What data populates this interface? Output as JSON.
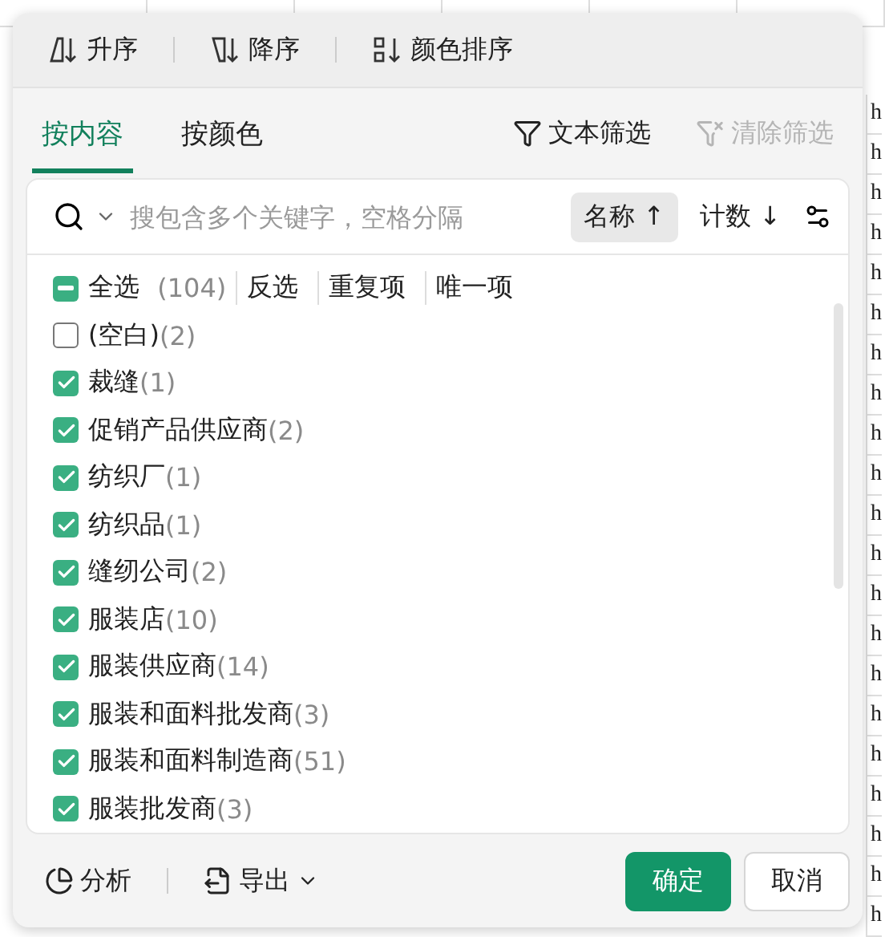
{
  "sort_toolbar": [
    {
      "label": "升序",
      "kind": "ascending"
    },
    {
      "label": "降序",
      "kind": "descending"
    },
    {
      "label": "颜色排序",
      "kind": "color"
    }
  ],
  "tabs": [
    {
      "label": "按内容",
      "selected": true
    },
    {
      "label": "按颜色",
      "selected": false
    }
  ],
  "filter_actions": [
    {
      "label": "文本筛选",
      "disabled": false
    },
    {
      "label": "清除筛选",
      "disabled": true
    }
  ],
  "search": {
    "placeholder": "搜包含多个关键字，空格分隔"
  },
  "sort_options": [
    {
      "label": "名称 ↑",
      "selected": true
    },
    {
      "label": "计数 ↓",
      "selected": false
    }
  ],
  "select_all": {
    "label": "全选",
    "count": "(104)",
    "checked": true,
    "indeterminate": true,
    "links": [
      "反选",
      "重复项",
      "唯一项"
    ]
  },
  "items": [
    {
      "name": "(空白)",
      "count": "(2)",
      "checked": false
    },
    {
      "name": "裁缝",
      "count": "(1)",
      "checked": true
    },
    {
      "name": "促销产品供应商",
      "count": "(2)",
      "checked": true
    },
    {
      "name": "纺织厂",
      "count": "(1)",
      "checked": true
    },
    {
      "name": "纺织品",
      "count": "(1)",
      "checked": true
    },
    {
      "name": "缝纫公司",
      "count": "(2)",
      "checked": true
    },
    {
      "name": "服装店",
      "count": "(10)",
      "checked": true
    },
    {
      "name": "服装供应商",
      "count": "(14)",
      "checked": true
    },
    {
      "name": "服装和面料批发商",
      "count": "(3)",
      "checked": true
    },
    {
      "name": "服装和面料制造商",
      "count": "(51)",
      "checked": true
    },
    {
      "name": "服装批发商",
      "count": "(3)",
      "checked": true
    }
  ],
  "footer": {
    "tools": [
      {
        "label": "分析",
        "kind": "analyze"
      },
      {
        "label": "导出",
        "kind": "export"
      }
    ],
    "buttons": [
      {
        "label": "确定",
        "kind": "primary"
      },
      {
        "label": "取消",
        "kind": "secondary"
      }
    ]
  },
  "sheet_column": [
    "h",
    "h",
    "h",
    "h",
    "h",
    "h",
    "h",
    "h",
    "h",
    "h",
    "h",
    "h",
    "h",
    "h",
    "h",
    "h",
    "h",
    "h",
    "h",
    "h",
    "h"
  ]
}
